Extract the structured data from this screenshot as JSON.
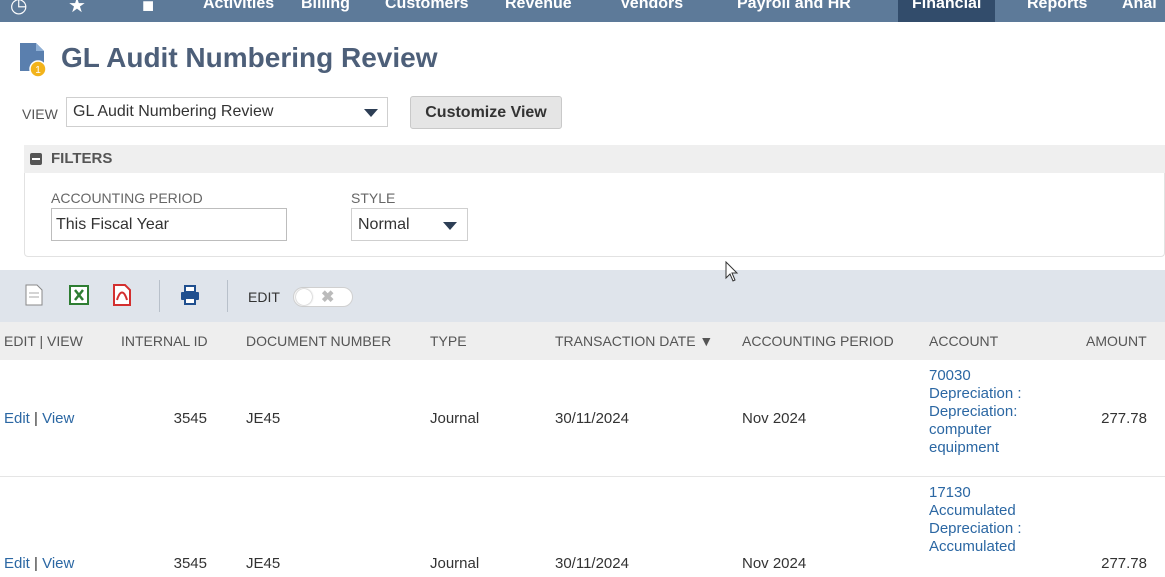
{
  "nav": {
    "items": [
      "Activities",
      "Billing",
      "Customers",
      "Revenue",
      "Vendors",
      "Payroll and HR",
      "Financial",
      "Reports",
      "Anal"
    ],
    "active": "Financial"
  },
  "page": {
    "title": "GL Audit Numbering Review"
  },
  "view": {
    "label": "VIEW",
    "selected": "GL Audit Numbering Review",
    "customize_label": "Customize View"
  },
  "filters": {
    "title": "FILTERS",
    "accounting_period_label": "ACCOUNTING PERIOD",
    "accounting_period_value": "This Fiscal Year",
    "style_label": "STYLE",
    "style_value": "Normal"
  },
  "toolbar": {
    "edit_label": "EDIT"
  },
  "table": {
    "headers": [
      "EDIT | VIEW",
      "INTERNAL ID",
      "DOCUMENT NUMBER",
      "TYPE",
      "TRANSACTION DATE ▼",
      "ACCOUNTING PERIOD",
      "ACCOUNT",
      "AMOUNT"
    ],
    "rows": [
      {
        "edit": "Edit",
        "sep": "|",
        "view": "View",
        "internal_id": "3545",
        "document_number": "JE45",
        "type": "Journal",
        "transaction_date": "30/11/2024",
        "accounting_period": "Nov 2024",
        "account": "70030 Depreciation : Depreciation: computer equipment",
        "amount": "277.78"
      },
      {
        "edit": "Edit",
        "sep": "|",
        "view": "View",
        "internal_id": "3545",
        "document_number": "JE45",
        "type": "Journal",
        "transaction_date": "30/11/2024",
        "accounting_period": "Nov 2024",
        "account": "17130 Accumulated Depreciation : Accumulated",
        "amount": "277.78"
      }
    ]
  },
  "colors": {
    "nav_bg": "#5d7a99",
    "nav_active": "#324c6b",
    "title": "#4d5f79",
    "link": "#2b67a3",
    "toolbar_bg": "#dfe4eb"
  }
}
